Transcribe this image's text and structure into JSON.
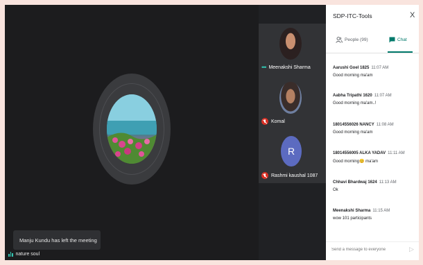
{
  "panel": {
    "title": "SDP-ITC-Tools",
    "close_label": "X",
    "tabs": {
      "people": "People (99)",
      "chat": "Chat"
    }
  },
  "messages": [
    {
      "sender": "Aarushi Goel 1825",
      "time": "11:07 AM",
      "text": "Good morning ma'am"
    },
    {
      "sender": "Aabha Tripathi 1620",
      "time": "11:07 AM",
      "text": "Good morning ma'am..!"
    },
    {
      "sender": "18014556026 NANCY",
      "time": "11:08 AM",
      "text": "Good morning ma'am"
    },
    {
      "sender": "18014556005 ALKA YADAV",
      "time": "11:11 AM",
      "text": "Good morning😊 ma'am"
    },
    {
      "sender": "Chhavi Bhardwaj 1624",
      "time": "11:13 AM",
      "text": "Ok"
    },
    {
      "sender": "Meenakshi Sharma",
      "time": "11:15 AM",
      "text": "wow 101 participants"
    }
  ],
  "chat_input": {
    "placeholder": "Send a message to everyone"
  },
  "participants": [
    {
      "name": "Meenakshi Sharma",
      "state": "speaking"
    },
    {
      "name": "Komal",
      "state": "muted"
    },
    {
      "name": "Rashmi kaushal 1087",
      "state": "muted",
      "initial": "R"
    }
  ],
  "notification": "Manju Kundu has left the meeting",
  "self_name": "nature soul",
  "colors": {
    "accent": "#00796b",
    "muted": "#d93025",
    "audio": "#33c3b0"
  }
}
